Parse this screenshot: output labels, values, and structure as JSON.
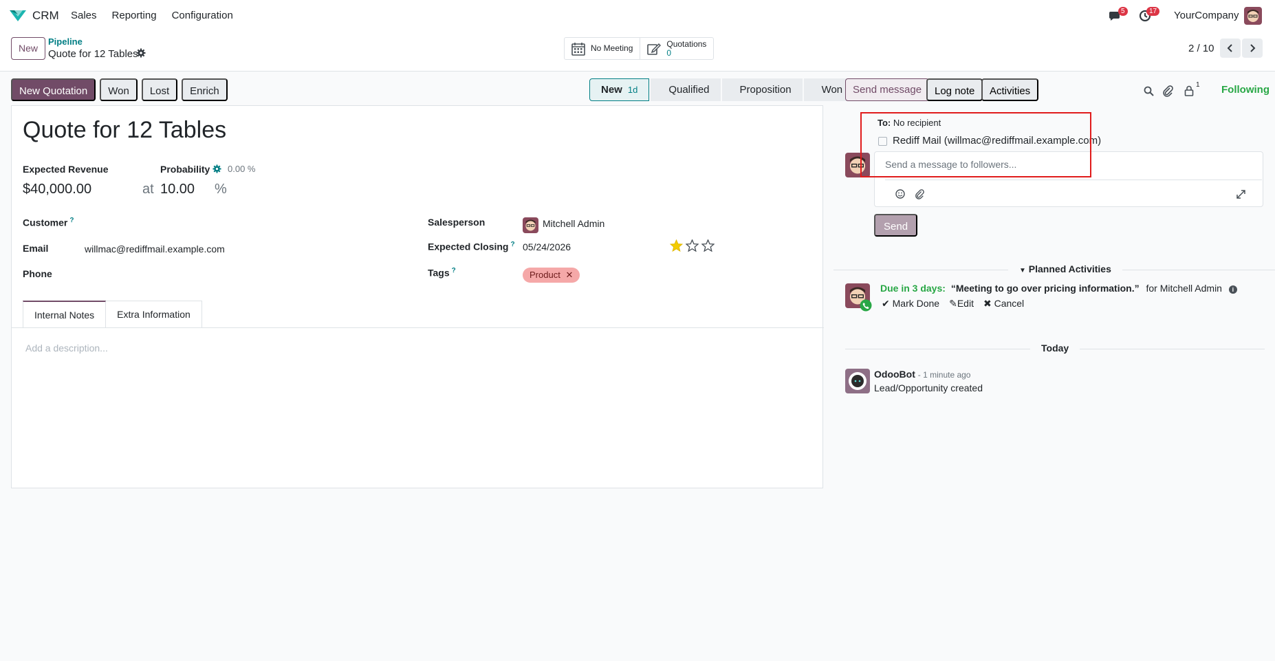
{
  "topbar": {
    "app_name": "CRM",
    "menu": [
      "Sales",
      "Reporting",
      "Configuration"
    ],
    "messages_count": "5",
    "activities_count": "17",
    "company": "YourCompany"
  },
  "control": {
    "new_label": "New",
    "breadcrumb_parent": "Pipeline",
    "breadcrumb_current": "Quote for 12 Tables",
    "meeting_label": "No Meeting",
    "quotations_label": "Quotations",
    "quotations_count": "0",
    "pager": "2 / 10"
  },
  "actions": {
    "new_quotation": "New Quotation",
    "won": "Won",
    "lost": "Lost",
    "enrich": "Enrich"
  },
  "stages": {
    "items": [
      "New",
      "Qualified",
      "Proposition",
      "Won"
    ],
    "current_days": "1d"
  },
  "record": {
    "title": "Quote for 12 Tables",
    "expected_revenue_label": "Expected Revenue",
    "expected_revenue": "$40,000.00",
    "at": "at",
    "probability_label": "Probability",
    "probability_auto": "0.00 %",
    "probability": "10.00",
    "percent": "%",
    "customer_label": "Customer",
    "email_label": "Email",
    "email": "willmac@rediffmail.example.com",
    "phone_label": "Phone",
    "salesperson_label": "Salesperson",
    "salesperson": "Mitchell Admin",
    "closing_label": "Expected Closing",
    "closing": "05/24/2026",
    "tags_label": "Tags",
    "tag": "Product",
    "priority_stars": 1,
    "help_mark": "?"
  },
  "tabs": {
    "internal_notes": "Internal Notes",
    "extra_info": "Extra Information",
    "description_placeholder": "Add a description..."
  },
  "chatter": {
    "send_message": "Send message",
    "log_note": "Log note",
    "activities": "Activities",
    "followers_count": "1",
    "following": "Following",
    "to_label": "To:",
    "to_value": "No recipient",
    "suggested_recipient": "Rediff Mail (willmac@rediffmail.example.com)",
    "composer_placeholder": "Send a message to followers...",
    "send": "Send",
    "planned_activities": "Planned Activities",
    "activity_due": "Due in 3 days:",
    "activity_summary": "“Meeting to go over pricing information.”",
    "activity_for": "for Mitchell Admin",
    "mark_done": "Mark Done",
    "edit": "Edit",
    "cancel": "Cancel",
    "today": "Today",
    "author": "OdooBot",
    "time": "- 1 minute ago",
    "message": "Lead/Opportunity created"
  },
  "colors": {
    "brand": "#714b67",
    "accent": "#017e84",
    "success": "#28a745",
    "danger": "#dc3545"
  }
}
